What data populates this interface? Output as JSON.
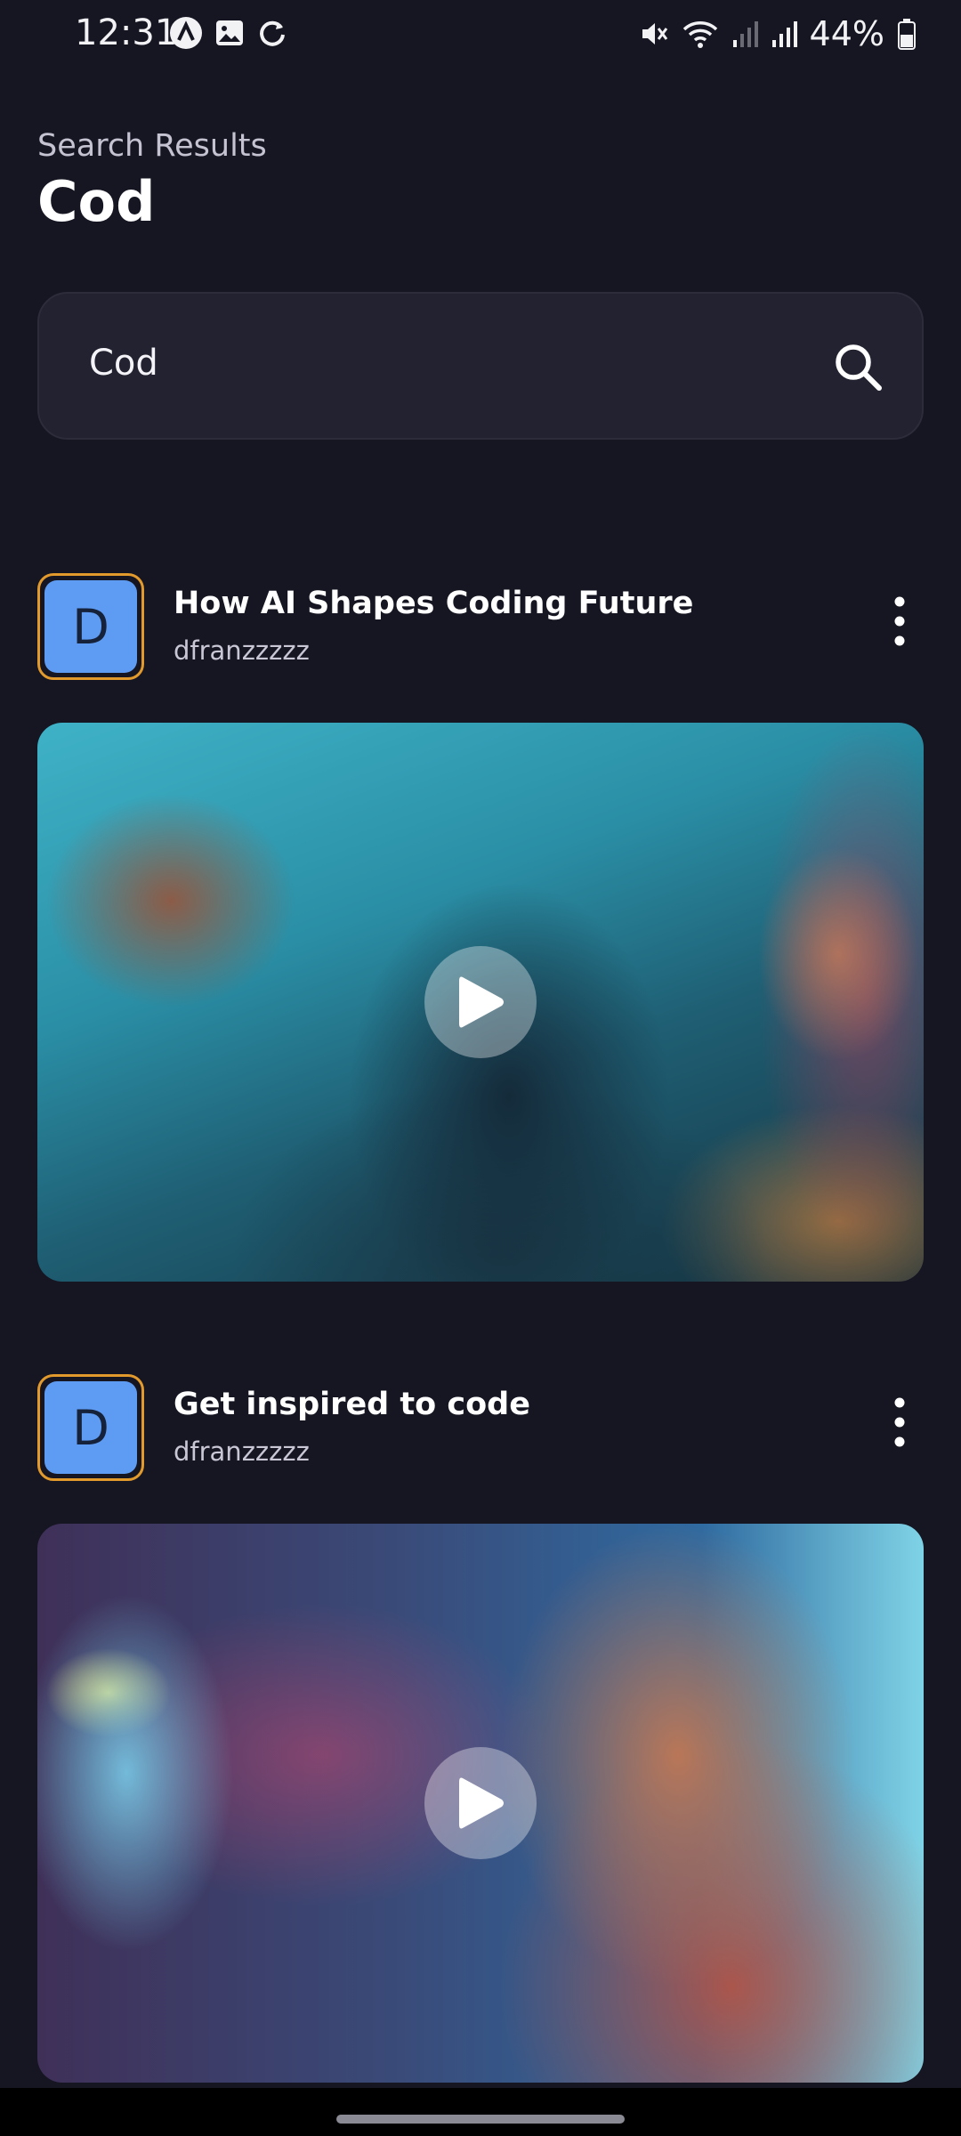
{
  "status_bar": {
    "time": "12:31",
    "battery": "44%",
    "icons": [
      "app-a-icon",
      "gallery-icon",
      "sync-icon",
      "mute-icon",
      "wifi-icon",
      "signal-icon",
      "signal-icon",
      "battery-icon"
    ]
  },
  "header": {
    "subtitle": "Search Results",
    "title": "Cod"
  },
  "search": {
    "value": "Cod",
    "icon": "search-icon"
  },
  "posts": [
    {
      "avatar_letter": "D",
      "title": "How AI Shapes Coding Future",
      "author": "dfranzzzzz"
    },
    {
      "avatar_letter": "D",
      "title": "Get inspired to code",
      "author": "dfranzzzzz"
    }
  ],
  "colors": {
    "background": "#161623",
    "search_bg": "#222230",
    "avatar_border": "#e39a2c",
    "avatar_fill": "#5d9cf2"
  }
}
